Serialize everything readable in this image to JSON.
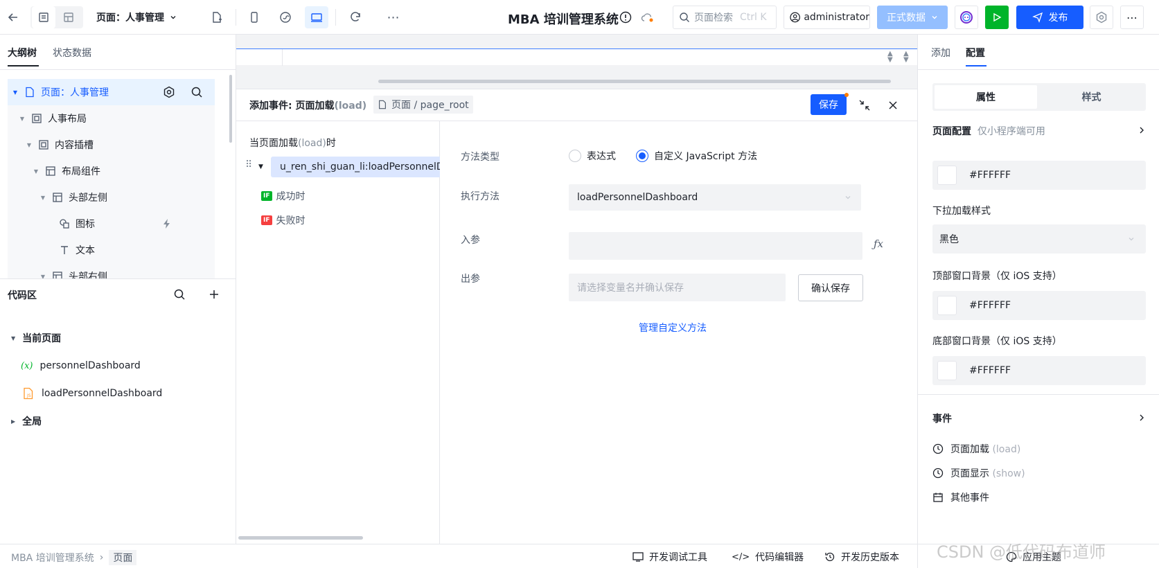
{
  "topbar": {
    "page_selector": "页面：人事管理",
    "app_title": "MBA 培训管理系统",
    "search_placeholder": "页面检索",
    "search_shortcut": "Ctrl K",
    "user": "administrator",
    "data_env": "正式数据",
    "publish": "发布"
  },
  "left": {
    "tabs": [
      "大纲树",
      "状态数据"
    ],
    "tree": [
      {
        "label": "页面：人事管理",
        "level": 0
      },
      {
        "label": "人事布局",
        "level": 1
      },
      {
        "label": "内容插槽",
        "level": 2
      },
      {
        "label": "布局组件",
        "level": 3
      },
      {
        "label": "头部左侧",
        "level": 4
      },
      {
        "label": "图标",
        "level": 5
      },
      {
        "label": "文本",
        "level": 5
      },
      {
        "label": "头部右侧",
        "level": 4
      }
    ],
    "code_title": "代码区",
    "code_current": "当前页面",
    "code_items": [
      "personnelDashboard",
      "loadPersonnelDashboard"
    ],
    "code_global": "全局"
  },
  "event": {
    "title_prefix": "添加事件: 页面加载",
    "title_suffix": "(load)",
    "breadcrumb": "页面 / page_root",
    "save": "保存",
    "trigger_prefix": "当页面加载",
    "trigger_event": "(load)",
    "trigger_suffix": "时",
    "action_name": "u_ren_shi_guan_li:loadPersonnelDa",
    "on_success": "成功时",
    "on_fail": "失败时",
    "if_badge": "IF",
    "method_type_label": "方法类型",
    "opt_expression": "表达式",
    "opt_custom": "自定义 JavaScript 方法",
    "exec_label": "执行方法",
    "exec_value": "loadPersonnelDashboard",
    "input_label": "入参",
    "output_label": "出参",
    "output_placeholder": "请选择变量名并确认保存",
    "confirm_save": "确认保存",
    "manage_link": "管理自定义方法"
  },
  "right": {
    "tabs": [
      "添加",
      "配置"
    ],
    "segments": [
      "属性",
      "样式"
    ],
    "page_config": "页面配置",
    "page_config_note": "仅小程序端可用",
    "bg_color": "#FFFFFF",
    "pull_label": "下拉加载样式",
    "pull_value": "黑色",
    "top_bg_label": "顶部窗口背景（仅 iOS 支持）",
    "top_bg_color": "#FFFFFF",
    "bottom_bg_label": "底部窗口背景（仅 iOS 支持）",
    "bottom_bg_color": "#FFFFFF",
    "events_title": "事件",
    "event_items": [
      {
        "label": "页面加载",
        "note": "(load)"
      },
      {
        "label": "页面显示",
        "note": "(show)"
      },
      {
        "label": "其他事件",
        "note": ""
      }
    ]
  },
  "bottom": {
    "crumb_app": "MBA 培训管理系统",
    "crumb_page": "页面",
    "dev_tools": "开发调试工具",
    "code_editor": "代码编辑器",
    "history": "开发历史版本",
    "theme": "应用主题",
    "watermark": "CSDN @低代码布道师"
  },
  "colors": {
    "accent": "#165dff",
    "green": "#00b42a",
    "red": "#f53f3f"
  }
}
